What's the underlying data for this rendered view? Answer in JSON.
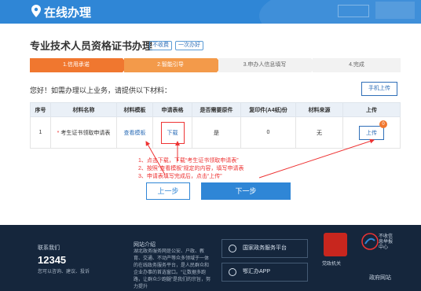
{
  "banner": {
    "title": "在线办理"
  },
  "page": {
    "title": "专业技术人员资格证书办理",
    "tags": [
      "不收费",
      "一次办好"
    ],
    "steps": [
      "1.信用承诺",
      "2.智能引导",
      "3.申办人信息填写",
      "4.完成"
    ],
    "hint": "您好！如需办理以上业务，请提供以下材料：",
    "mobile_upload": "手机上传"
  },
  "table": {
    "headers": [
      "序号",
      "材料名称",
      "材料模板",
      "申请表格",
      "是否需要原件",
      "复印件(A4纸)份",
      "材料来源",
      "上传"
    ],
    "rows": [
      {
        "no": "1",
        "required_mark": "*",
        "name": "考生证书领取申请表",
        "template": "查看模板",
        "form": "下载",
        "original": "是",
        "copies": "0",
        "source": "无",
        "upload": "上传",
        "badge": "0"
      }
    ]
  },
  "annotation": {
    "line1": "1、点击下载，下载“考生证书领取申请表”",
    "line2": "2、按照“查看模板”规定的内容，填写申请表",
    "line3": "3、申请表填写完成后，点击“上传”"
  },
  "nav": {
    "prev": "上一步",
    "next": "下一步"
  },
  "footer": {
    "contact_title": "联系我们",
    "phone": "12345",
    "contact_sub": "您可以咨询、建议、投诉",
    "intro_title": "网站介绍",
    "intro_text": "湖北政务服务网是公安、户政、教育、交通、不动产等众多领域于一体的在线政务服务平台，是人民群众和企业办事的首选窗口。“让数据多跑路，让群众少跑腿”是我们的宗旨，努力提升",
    "platform_btn": "国家政务服务平台",
    "app_btn": "鄂汇办APP",
    "party_label": "党政机关",
    "gov_label1": "不收信",
    "gov_label2": "息举报",
    "gov_label3": "中心",
    "gov_site": "政府网站"
  }
}
